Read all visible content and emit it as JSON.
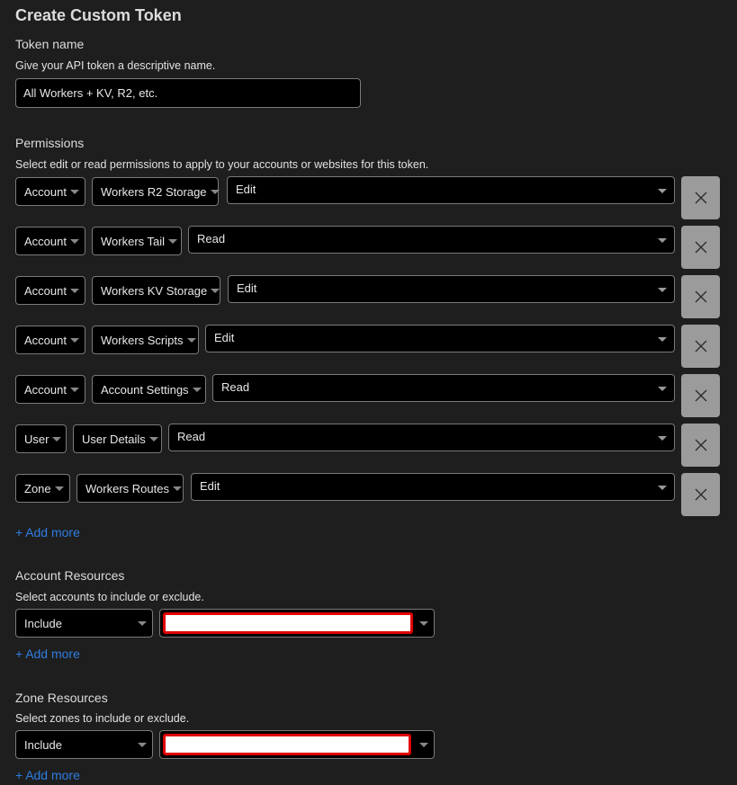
{
  "page": {
    "title": "Create Custom Token"
  },
  "token_name": {
    "label": "Token name",
    "description": "Give your API token a descriptive name.",
    "value": "All Workers + KV, R2, etc."
  },
  "permissions": {
    "label": "Permissions",
    "description": "Select edit or read permissions to apply to your accounts or websites for this token.",
    "rows": [
      {
        "scope": "Account",
        "resource": "Workers R2 Storage",
        "access": "Edit"
      },
      {
        "scope": "Account",
        "resource": "Workers Tail",
        "access": "Read"
      },
      {
        "scope": "Account",
        "resource": "Workers KV Storage",
        "access": "Edit"
      },
      {
        "scope": "Account",
        "resource": "Workers Scripts",
        "access": "Edit"
      },
      {
        "scope": "Account",
        "resource": "Account Settings",
        "access": "Read"
      },
      {
        "scope": "User",
        "resource": "User Details",
        "access": "Read"
      },
      {
        "scope": "Zone",
        "resource": "Workers Routes",
        "access": "Edit"
      }
    ],
    "add_more": "Add more"
  },
  "account_resources": {
    "label": "Account Resources",
    "description": "Select accounts to include or exclude.",
    "mode": "Include",
    "value": "",
    "add_more": "Add more"
  },
  "zone_resources": {
    "label": "Zone Resources",
    "description": "Select zones to include or exclude.",
    "mode": "Include",
    "value": "",
    "add_more": "Add more"
  },
  "icons": {
    "remove": "close-icon",
    "dropdown": "caret-down-icon",
    "add": "plus-icon"
  },
  "colors": {
    "background": "#1e1e1e",
    "input_bg": "#000000",
    "link": "#2f7de1",
    "remove_button": "#9b9b9b",
    "redaction_border": "#e00000"
  }
}
